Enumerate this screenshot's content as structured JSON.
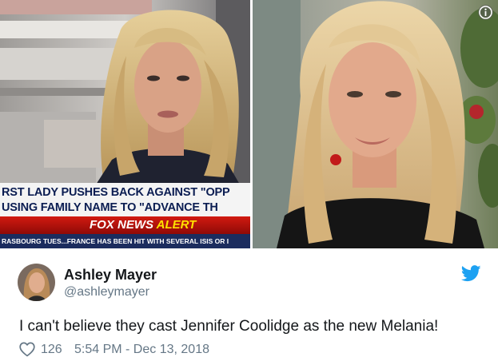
{
  "media": {
    "left_photo_alt": "",
    "chyron": {
      "headline_line1": "RST LADY PUSHES BACK AGAINST \"OPP",
      "headline_line2": "USING FAMILY NAME TO \"ADVANCE TH",
      "alert_brand": "FOX NEWS ",
      "alert_word": "ALERT",
      "ticker": "RASBOURG TUES...FRANCE HAS BEEN HIT WITH SEVERAL ISIS OR I"
    }
  },
  "tweet": {
    "author_name": "Ashley Mayer",
    "author_handle": "@ashleymayer",
    "text": "I can't believe they cast Jennifer Coolidge as the new Melania!",
    "like_count": "126",
    "timestamp": "5:54 PM - Dec 13, 2018"
  },
  "colors": {
    "text_primary": "#14171a",
    "text_secondary": "#657786",
    "twitter_blue": "#1da1f2",
    "chyron_navy": "#0b1d52",
    "alert_red": "#c4140b",
    "alert_yellow": "#ffe200"
  },
  "icons": [
    "info-icon",
    "twitter-bird-icon",
    "heart-icon"
  ]
}
